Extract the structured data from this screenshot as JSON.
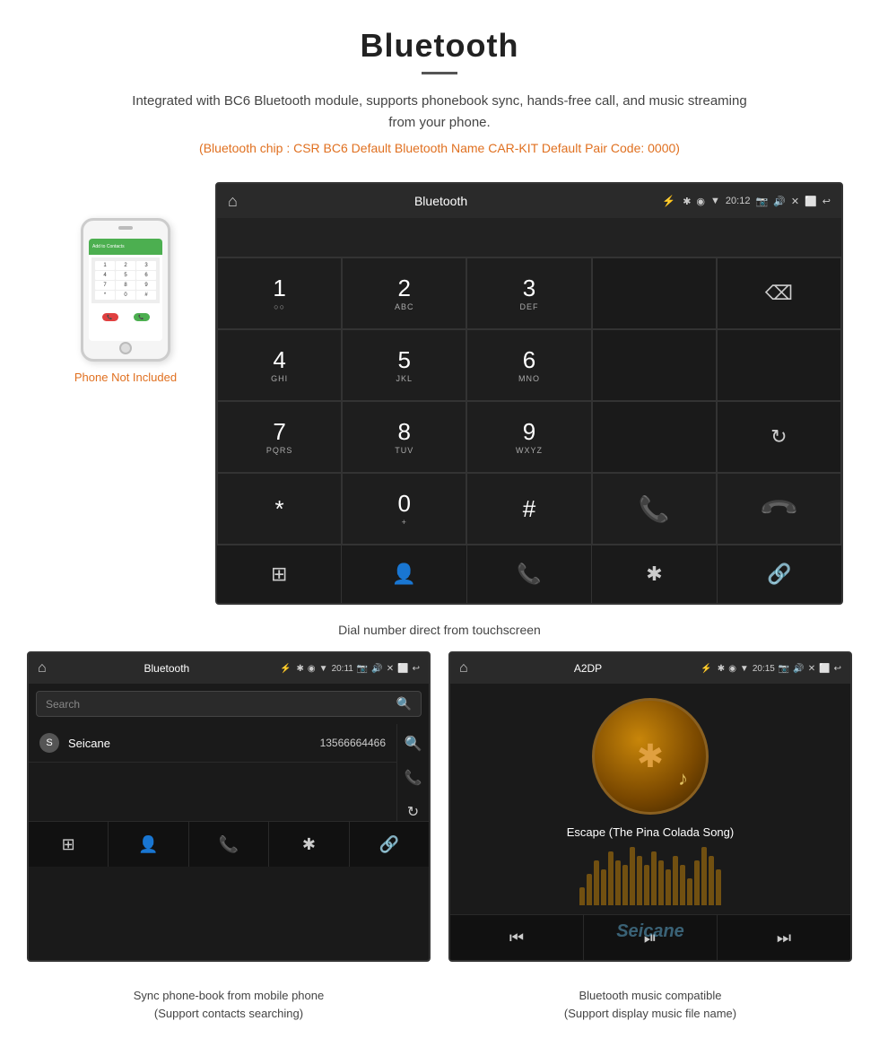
{
  "header": {
    "title": "Bluetooth",
    "description": "Integrated with BC6 Bluetooth module, supports phonebook sync, hands-free call, and music streaming from your phone.",
    "specs": "(Bluetooth chip : CSR BC6    Default Bluetooth Name CAR-KIT    Default Pair Code: 0000)"
  },
  "phone_label": "Phone Not Included",
  "dial_screen": {
    "status_bar": {
      "home_icon": "⌂",
      "title": "Bluetooth",
      "usb_icon": "⚡",
      "time": "20:12",
      "bt_icon": "✱",
      "location_icon": "◉",
      "signal_icon": "▾",
      "camera_icon": "📷",
      "volume_icon": "🔊",
      "close_icon": "✕",
      "window_icon": "⬜",
      "back_icon": "↩"
    },
    "keys": [
      {
        "num": "1",
        "sub": "○○"
      },
      {
        "num": "2",
        "sub": "ABC"
      },
      {
        "num": "3",
        "sub": "DEF"
      },
      {
        "num": "",
        "sub": ""
      },
      {
        "num": "",
        "sub": "",
        "backspace": true
      },
      {
        "num": "4",
        "sub": "GHI"
      },
      {
        "num": "5",
        "sub": "JKL"
      },
      {
        "num": "6",
        "sub": "MNO"
      },
      {
        "num": "",
        "sub": ""
      },
      {
        "num": "",
        "sub": ""
      },
      {
        "num": "7",
        "sub": "PQRS"
      },
      {
        "num": "8",
        "sub": "TUV"
      },
      {
        "num": "9",
        "sub": "WXYZ"
      },
      {
        "num": "",
        "sub": ""
      },
      {
        "num": "↻",
        "sub": ""
      },
      {
        "num": "*",
        "sub": ""
      },
      {
        "num": "0",
        "sub": "+"
      },
      {
        "num": "#",
        "sub": ""
      },
      {
        "num": "📞",
        "sub": "",
        "green": true
      },
      {
        "num": "📞",
        "sub": "",
        "red": true
      }
    ],
    "bottom_icons": [
      "⊞",
      "👤",
      "📞",
      "✱",
      "🔗"
    ]
  },
  "dial_caption": "Dial number direct from touchscreen",
  "phonebook_panel": {
    "status_bar_title": "Bluetooth",
    "usb_icon": "⚡",
    "time": "20:11",
    "search_placeholder": "Search",
    "contacts": [
      {
        "letter": "S",
        "name": "Seicane",
        "number": "13566664466"
      }
    ],
    "bottom_icons": [
      "⊞",
      "👤",
      "📞",
      "✱",
      "🔗"
    ],
    "caption_line1": "Sync phone-book from mobile phone",
    "caption_line2": "(Support contacts searching)"
  },
  "music_panel": {
    "status_bar_title": "A2DP",
    "time": "20:15",
    "song_title": "Escape (The Pina Colada Song)",
    "eq_bars": [
      20,
      35,
      50,
      40,
      60,
      70,
      55,
      45,
      65,
      80,
      60,
      50,
      40,
      55,
      70,
      45,
      30,
      50,
      65,
      55
    ],
    "bottom_icons": [
      "⏮",
      "⏯",
      "⏭"
    ],
    "caption_line1": "Bluetooth music compatible",
    "caption_line2": "(Support display music file name)",
    "watermark": "Seicane"
  }
}
